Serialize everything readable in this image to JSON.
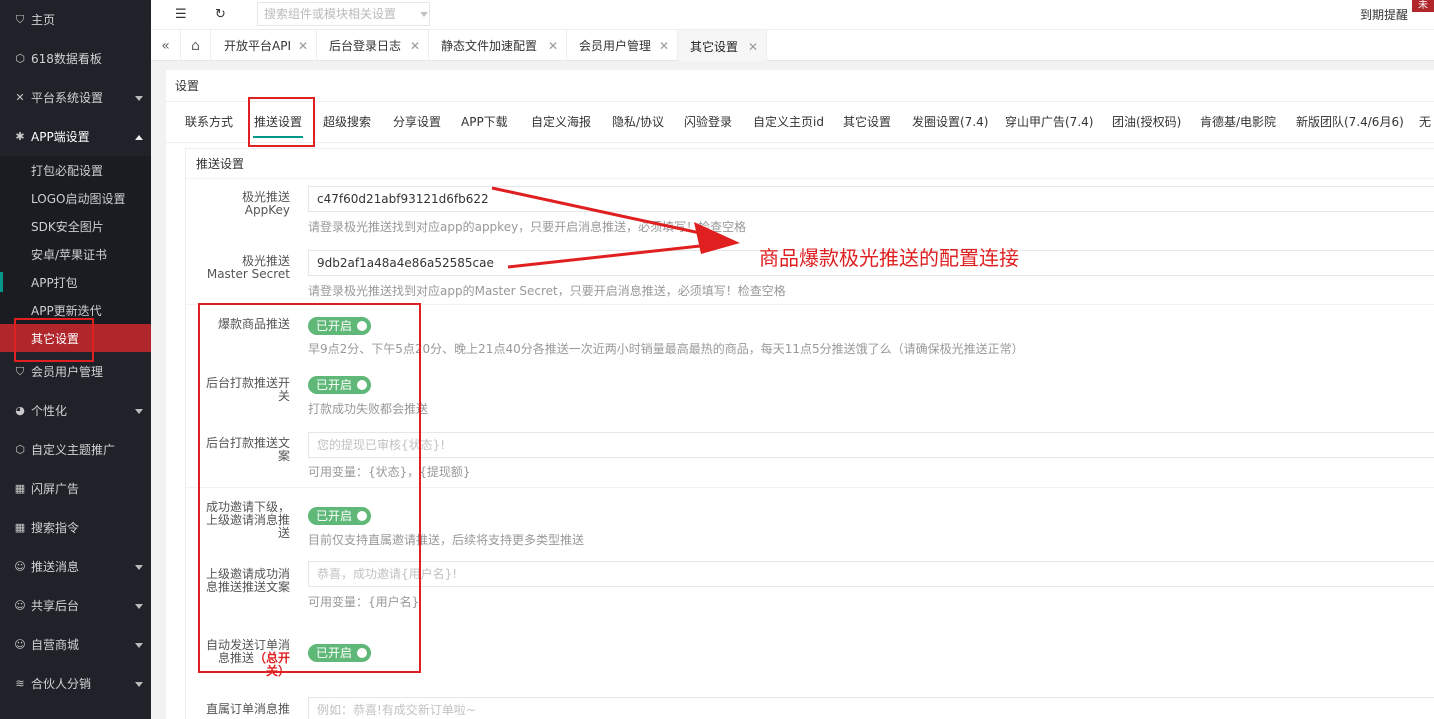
{
  "sidebar": {
    "items": [
      {
        "label": "主页",
        "icon": "home-icon"
      },
      {
        "label": "618数据看板",
        "icon": "cube-icon"
      },
      {
        "label": "平台系统设置",
        "icon": "tools-icon"
      },
      {
        "label": "APP端设置",
        "icon": "gear-icon"
      },
      {
        "label": "会员用户管理",
        "icon": "shield-icon"
      },
      {
        "label": "个性化",
        "icon": "palette-icon"
      },
      {
        "label": "自定义主题推广",
        "icon": "cube-icon"
      },
      {
        "label": "闪屏广告",
        "icon": "grid-icon"
      },
      {
        "label": "搜索指令",
        "icon": "grid-icon"
      },
      {
        "label": "推送消息",
        "icon": "user-icon"
      },
      {
        "label": "共享后台",
        "icon": "user-icon"
      },
      {
        "label": "自营商城",
        "icon": "user-icon"
      },
      {
        "label": "合伙人分销",
        "icon": "layers-icon"
      }
    ],
    "app_sub": [
      {
        "label": "打包必配设置"
      },
      {
        "label": "LOGO启动图设置"
      },
      {
        "label": "SDK安全图片"
      },
      {
        "label": "安卓/苹果证书"
      },
      {
        "label": "APP打包"
      },
      {
        "label": "APP更新迭代"
      },
      {
        "label": "其它设置"
      }
    ]
  },
  "header": {
    "search_placeholder": "搜索组件或模块相关设置",
    "expire_label": "到期提醒",
    "expire_badge": "未"
  },
  "page_tabs": [
    {
      "label": "开放平台API"
    },
    {
      "label": "后台登录日志"
    },
    {
      "label": "静态文件加速配置"
    },
    {
      "label": "会员用户管理"
    },
    {
      "label": "其它设置"
    }
  ],
  "content": {
    "title": "设置",
    "subtabs": [
      "联系方式",
      "推送设置",
      "超级搜索",
      "分享设置",
      "APP下载",
      "自定义海报",
      "隐私/协议",
      "闪验登录",
      "自定义主页id",
      "其它设置",
      "发圈设置(7.4)",
      "穿山甲广告(7.4)",
      "团油(授权码)",
      "肯德基/电影院",
      "新版团队(7.4/6月6)",
      "无"
    ],
    "panel_title": "推送设置",
    "fields": {
      "appkey_label_1": "极光推送",
      "appkey_label_2": "AppKey",
      "appkey_value": "c47f60d21abf93121d6fb622",
      "appkey_hint": "请登录极光推送找到对应app的appkey，只要开启消息推送，必须填写！检查空格",
      "secret_label_1": "极光推送",
      "secret_label_2": "Master Secret",
      "secret_value": "9db2af1a48a4e86a52585cae",
      "secret_hint": "请登录极光推送找到对应app的Master Secret，只要开启消息推送，必须填写！检查空格",
      "hot_label": "爆款商品推送",
      "hot_switch": "已开启",
      "hot_hint": "早9点2分、下午5点20分、晚上21点40分各推送一次近两小时销量最高最热的商品，每天11点5分推送饿了么（请确保极光推送正常）",
      "withdraw_label_1": "后台打款推送开",
      "withdraw_label_2": "关",
      "withdraw_switch": "已开启",
      "withdraw_hint": "打款成功失败都会推送",
      "withdraw_text_label_1": "后台打款推送文",
      "withdraw_text_label_2": "案",
      "withdraw_text_placeholder": "您的提现已审核{状态}!",
      "withdraw_text_hint": "可用变量：{状态}，{提现额}",
      "invite_label_1": "成功邀请下级，",
      "invite_label_2": "上级邀请消息推",
      "invite_label_3": "送",
      "invite_switch": "已开启",
      "invite_hint": "目前仅支持直属邀请推送，后续将支持更多类型推送",
      "invite_text_label_1": "上级邀请成功消",
      "invite_text_label_2": "息推送推送文案",
      "invite_text_placeholder": "恭喜，成功邀请{用户名}!",
      "invite_text_hint": "可用变量：{用户名}",
      "order_label_1": "自动发送订单消",
      "order_label_2": "息推送",
      "order_label_3": "（总开",
      "order_label_4": "关）",
      "order_switch": "已开启",
      "direct_label": "直属订单消息推",
      "direct_placeholder": "例如：恭喜!有成交新订单啦~"
    }
  },
  "annotation": "商品爆款极光推送的配置连接",
  "colors": {
    "sidebar_bg": "#20222a",
    "active_red": "#b0262b",
    "switch_green": "#5fb878",
    "annot_red": "#e02020",
    "tab_green": "#009688"
  }
}
